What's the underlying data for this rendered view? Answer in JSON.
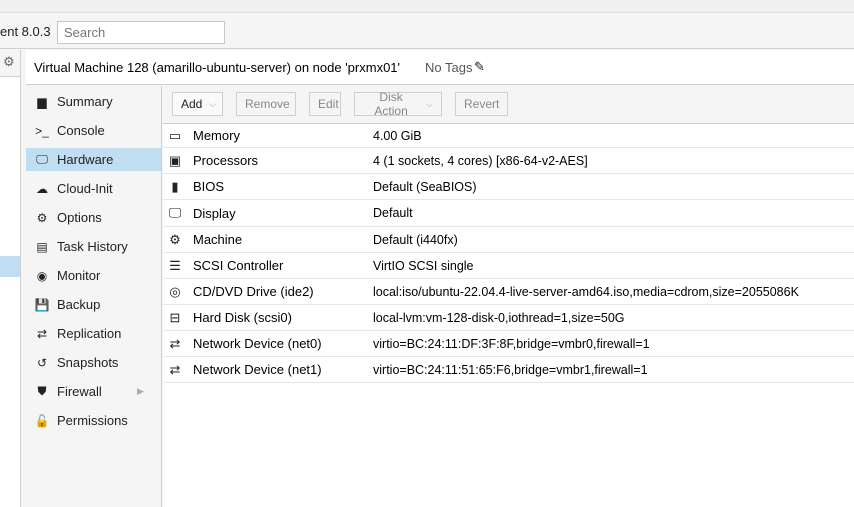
{
  "header": {
    "version_text": "ent 8.0.3",
    "search_placeholder": "Search"
  },
  "title": {
    "text": "Virtual Machine 128 (amarillo-ubuntu-server) on node 'prxmx01'",
    "tags": "No Tags"
  },
  "nav": [
    {
      "label": "Summary",
      "icon": "book-icon",
      "glyph": "▆"
    },
    {
      "label": "Console",
      "icon": "terminal-icon",
      "glyph": ">_"
    },
    {
      "label": "Hardware",
      "icon": "desktop-icon",
      "glyph": "🖵"
    },
    {
      "label": "Cloud-Init",
      "icon": "cloud-icon",
      "glyph": "☁"
    },
    {
      "label": "Options",
      "icon": "gear-icon",
      "glyph": "⚙"
    },
    {
      "label": "Task History",
      "icon": "list-icon",
      "glyph": "▤"
    },
    {
      "label": "Monitor",
      "icon": "eye-icon",
      "glyph": "◉"
    },
    {
      "label": "Backup",
      "icon": "floppy-icon",
      "glyph": "💾"
    },
    {
      "label": "Replication",
      "icon": "retweet-icon",
      "glyph": "⇄"
    },
    {
      "label": "Snapshots",
      "icon": "history-icon",
      "glyph": "↺"
    },
    {
      "label": "Firewall",
      "icon": "shield-icon",
      "glyph": "⛊"
    },
    {
      "label": "Permissions",
      "icon": "unlock-icon",
      "glyph": "🔓"
    }
  ],
  "nav_active": "Hardware",
  "toolbar": {
    "add": "Add",
    "remove": "Remove",
    "edit": "Edit",
    "disk_action": "Disk Action",
    "revert": "Revert"
  },
  "hardware": [
    {
      "name": "Memory",
      "value": "4.00 GiB",
      "icon": "memory-icon",
      "glyph": "▭"
    },
    {
      "name": "Processors",
      "value": "4 (1 sockets, 4 cores) [x86-64-v2-AES]",
      "icon": "cpu-icon",
      "glyph": "▣"
    },
    {
      "name": "BIOS",
      "value": "Default (SeaBIOS)",
      "icon": "chip-icon",
      "glyph": "▮"
    },
    {
      "name": "Display",
      "value": "Default",
      "icon": "desktop-icon",
      "glyph": "🖵"
    },
    {
      "name": "Machine",
      "value": "Default (i440fx)",
      "icon": "cogs-icon",
      "glyph": "⚙"
    },
    {
      "name": "SCSI Controller",
      "value": "VirtIO SCSI single",
      "icon": "database-icon",
      "glyph": "☰"
    },
    {
      "name": "CD/DVD Drive (ide2)",
      "value": "local:iso/ubuntu-22.04.4-live-server-amd64.iso,media=cdrom,size=2055086K",
      "icon": "cdrom-icon",
      "glyph": "◎"
    },
    {
      "name": "Hard Disk (scsi0)",
      "value": "local-lvm:vm-128-disk-0,iothread=1,size=50G",
      "icon": "hdd-icon",
      "glyph": "⊟"
    },
    {
      "name": "Network Device (net0)",
      "value": "virtio=BC:24:11:DF:3F:8F,bridge=vmbr0,firewall=1",
      "icon": "exchange-icon",
      "glyph": "⇄"
    },
    {
      "name": "Network Device (net1)",
      "value": "virtio=BC:24:11:51:65:F6,bridge=vmbr1,firewall=1",
      "icon": "exchange-icon",
      "glyph": "⇄"
    }
  ],
  "colors": {
    "selection": "#c1ddf1",
    "panel_bg": "#f5f5f5",
    "border": "#cfcfcf"
  }
}
